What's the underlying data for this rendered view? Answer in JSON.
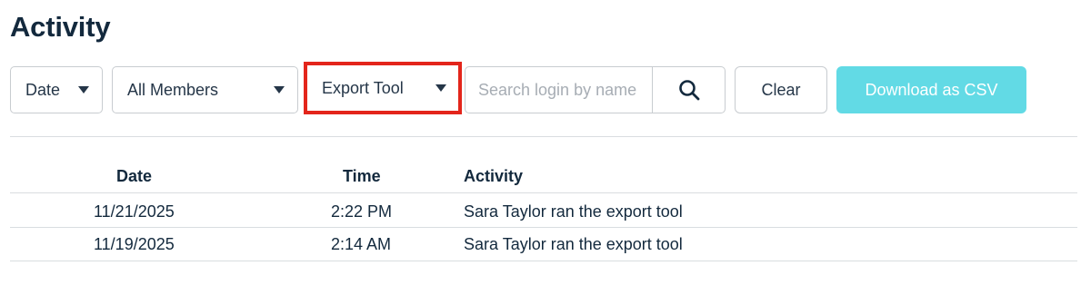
{
  "page": {
    "title": "Activity"
  },
  "filters": {
    "date": {
      "value": "Date"
    },
    "members": {
      "value": "All Members"
    },
    "activity_type": {
      "value": "Export Tool"
    },
    "search": {
      "placeholder": "Search login by name",
      "value": ""
    },
    "clear_label": "Clear",
    "download_label": "Download as CSV"
  },
  "table": {
    "headers": {
      "date": "Date",
      "time": "Time",
      "activity": "Activity"
    },
    "rows": [
      {
        "date": "11/21/2025",
        "time": "2:22 PM",
        "activity": "Sara Taylor ran the export tool"
      },
      {
        "date": "11/19/2025",
        "time": "2:14 AM",
        "activity": "Sara Taylor ran the export tool"
      }
    ]
  },
  "colors": {
    "accent_button": "#62dae5",
    "highlight_border": "#e3251b",
    "heading": "#13293d"
  },
  "icons": {
    "search": "search-icon",
    "dropdown": "chevron-down-icon"
  }
}
